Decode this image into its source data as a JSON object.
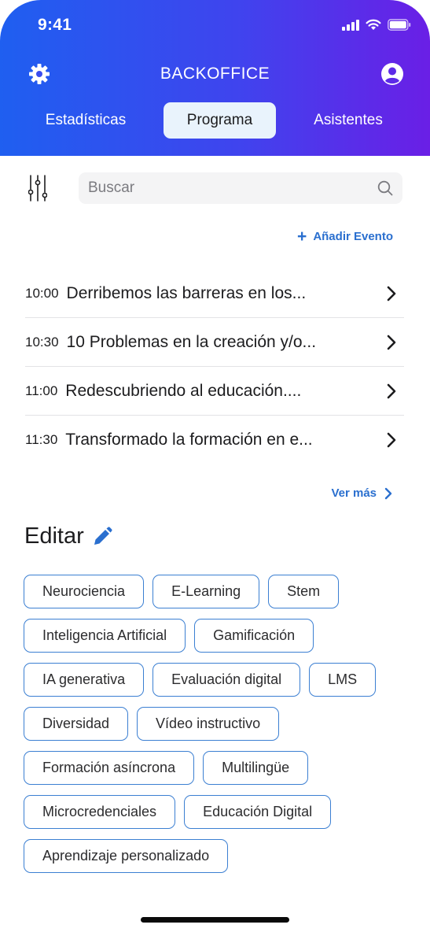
{
  "status_bar": {
    "time": "9:41"
  },
  "header": {
    "title": "BACKOFFICE"
  },
  "tabs": [
    {
      "label": "Estadísticas"
    },
    {
      "label": "Programa",
      "active": true
    },
    {
      "label": "Asistentes"
    }
  ],
  "search": {
    "placeholder": "Buscar",
    "value": ""
  },
  "add_event": {
    "label": "Añadir Evento"
  },
  "events": [
    {
      "time": "10:00",
      "title": "Derribemos las barreras en los..."
    },
    {
      "time": "10:30",
      "title": "10 Problemas en la creación y/o..."
    },
    {
      "time": "11:00",
      "title": "Redescubriendo al educación...."
    },
    {
      "time": "11:30",
      "title": "Transformado la formación en e..."
    }
  ],
  "see_more": {
    "label": "Ver más"
  },
  "edit_section": {
    "title": "Editar"
  },
  "tags": [
    "Neurociencia",
    "E-Learning",
    "Stem",
    "Inteligencia Artificial",
    "Gamificación",
    "IA generativa",
    "Evaluación digital",
    "LMS",
    "Diversidad",
    "Vídeo instructivo",
    "Formación asíncrona",
    "Multilingüe",
    "Microcredenciales",
    "Educación Digital",
    "Aprendizaje personalizado"
  ],
  "colors": {
    "accent": "#2a6fcf",
    "gradient_start": "#1f5ff0",
    "gradient_end": "#6a1fe6",
    "active_tab_bg": "#e9f3fc"
  },
  "icons": [
    "signal-icon",
    "wifi-icon",
    "battery-icon",
    "gear-icon",
    "user-circle-icon",
    "sliders-icon",
    "search-icon",
    "plus-icon",
    "chevron-right-icon",
    "pencil-icon"
  ]
}
